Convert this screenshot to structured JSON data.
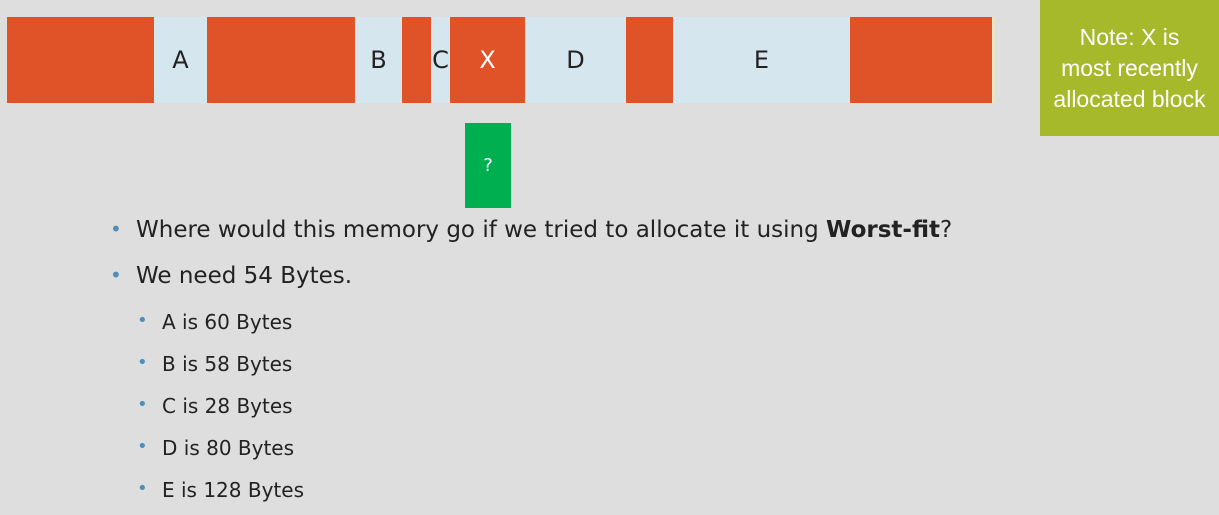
{
  "memory": {
    "segments": [
      {
        "label": "",
        "state": "allocated"
      },
      {
        "label": "A",
        "state": "free"
      },
      {
        "label": "",
        "state": "allocated"
      },
      {
        "label": "B",
        "state": "free"
      },
      {
        "label": "",
        "state": "allocated"
      },
      {
        "label": "C",
        "state": "free"
      },
      {
        "label": "X",
        "state": "allocated"
      },
      {
        "label": "D",
        "state": "free"
      },
      {
        "label": "",
        "state": "allocated"
      },
      {
        "label": "E",
        "state": "free"
      },
      {
        "label": "",
        "state": "allocated"
      }
    ]
  },
  "note": {
    "text": "Note: X is\nmost recently\nallocated block"
  },
  "request_block": {
    "label": "?"
  },
  "bullets": {
    "q_pre": "Where would this memory go if we tried to allocate it using ",
    "q_bold": "Worst-fit",
    "q_post": "?",
    "need": "We need 54 Bytes.",
    "sizes": [
      "A is 60 Bytes",
      "B is 58 Bytes",
      "C is 28 Bytes",
      "D is 80 Bytes",
      "E is 128 Bytes"
    ]
  },
  "colors": {
    "allocated": "#e05227",
    "free": "#d6e6ef",
    "note_bg": "#a5b92a",
    "request_bg": "#00b050",
    "bullet": "#4d8fb8",
    "background": "#dedede"
  }
}
